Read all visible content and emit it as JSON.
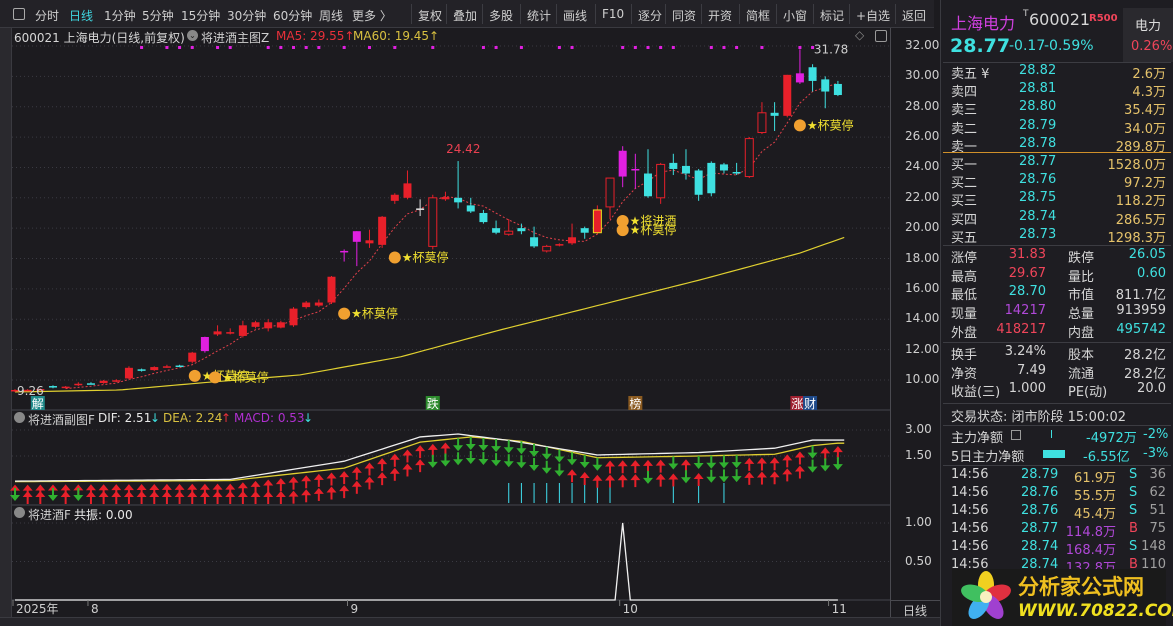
{
  "toolbar": {
    "periods": [
      "分时",
      "日线",
      "1分钟",
      "5分钟",
      "15分钟",
      "30分钟",
      "60分钟",
      "周线",
      "更多 〉"
    ],
    "active": "日线",
    "buttons": [
      "复权",
      "叠加",
      "多股",
      "统计",
      "画线",
      "F10",
      "逐分",
      "同资",
      "开资",
      "简框",
      "小窗",
      "标记",
      "+自选",
      "返回"
    ]
  },
  "header": {
    "title": "600021 上海电力(日线,前复权)",
    "indicator": "将进酒主图Z",
    "ma5": "MA5: 29.55↑",
    "ma60": "MA60: 19.45↑"
  },
  "macd_header": {
    "name": "将进酒副图F",
    "dif": "DIF: 2.51",
    "dif_arrow": "↓",
    "dea": "DEA: 2.24",
    "dea_arrow": "↑",
    "macd": "MACD: 0.53",
    "macd_arrow": "↓"
  },
  "res_header": {
    "name": "将进酒F",
    "value": "共振: 0.00"
  },
  "date_axis": {
    "labels": [
      {
        "text": "2025年",
        "i": 0
      },
      {
        "text": "8",
        "i": 6
      },
      {
        "text": "9",
        "i": 26.5
      },
      {
        "text": "10",
        "i": 48
      },
      {
        "text": "11",
        "i": 64.5
      }
    ],
    "period": "日线"
  },
  "event_tags": [
    {
      "text": "解",
      "i": 1.8,
      "color": "#1f8a8a"
    },
    {
      "text": "跌",
      "i": 33,
      "color": "#2c8a2c"
    },
    {
      "text": "榜",
      "i": 49,
      "color": "#8a5a20"
    },
    {
      "text": "涨",
      "i": 61.8,
      "color": "#a02030"
    },
    {
      "text": "财",
      "i": 62.8,
      "color": "#1f4a8a"
    }
  ],
  "chart_data": {
    "type": "candlestick",
    "price_axis": [
      "32.00",
      "30.00",
      "28.00",
      "26.00",
      "24.00",
      "22.00",
      "20.00",
      "18.00",
      "16.00",
      "14.00",
      "12.00",
      "10.00"
    ],
    "ylim": [
      10,
      32
    ],
    "candles": [
      [
        9.3,
        9.4,
        9.2,
        9.34
      ],
      [
        9.35,
        9.4,
        9.3,
        9.35
      ],
      [
        9.38,
        9.45,
        9.3,
        9.4
      ],
      [
        9.6,
        9.65,
        9.45,
        9.5
      ],
      [
        9.5,
        9.6,
        9.45,
        9.56
      ],
      [
        9.65,
        9.85,
        9.6,
        9.75
      ],
      [
        9.78,
        9.85,
        9.7,
        9.72
      ],
      [
        9.8,
        10.0,
        9.75,
        9.95
      ],
      [
        9.95,
        10.05,
        9.85,
        9.98
      ],
      [
        10.1,
        10.9,
        10.05,
        10.8
      ],
      [
        10.7,
        10.75,
        10.55,
        10.6
      ],
      [
        10.65,
        10.9,
        10.6,
        10.85
      ],
      [
        10.85,
        11.0,
        10.8,
        10.9
      ],
      [
        10.95,
        11.0,
        10.85,
        10.85
      ],
      [
        11.2,
        11.85,
        11.1,
        11.8
      ],
      [
        11.9,
        12.85,
        11.8,
        12.83
      ],
      [
        13.0,
        13.6,
        12.9,
        13.2
      ],
      [
        13.15,
        13.4,
        13.0,
        13.1
      ],
      [
        12.9,
        13.9,
        12.8,
        13.6
      ],
      [
        13.5,
        13.9,
        13.4,
        13.8
      ],
      [
        13.4,
        14.0,
        13.2,
        13.8
      ],
      [
        13.45,
        13.9,
        13.4,
        13.8
      ],
      [
        13.6,
        14.8,
        13.5,
        14.7
      ],
      [
        14.8,
        15.2,
        14.7,
        15.1
      ],
      [
        14.9,
        15.3,
        14.8,
        15.1
      ],
      [
        15.1,
        16.85,
        15.0,
        16.8
      ],
      [
        18.4,
        18.6,
        17.8,
        18.5
      ],
      [
        19.1,
        19.8,
        17.5,
        19.8
      ],
      [
        19.2,
        19.9,
        18.7,
        19.0
      ],
      [
        18.9,
        20.8,
        18.7,
        20.75
      ],
      [
        21.8,
        22.3,
        21.6,
        22.2
      ],
      [
        22.0,
        23.8,
        21.9,
        22.95
      ],
      [
        21.3,
        21.9,
        20.8,
        21.2
      ],
      [
        18.8,
        22.2,
        18.6,
        22.0
      ],
      [
        21.9,
        22.4,
        21.8,
        22.05
      ],
      [
        22.0,
        24.42,
        21.3,
        21.7
      ],
      [
        21.5,
        22.0,
        21.0,
        21.1
      ],
      [
        21.0,
        21.2,
        20.3,
        20.4
      ],
      [
        20.0,
        20.5,
        19.6,
        19.7
      ],
      [
        19.6,
        20.6,
        19.5,
        19.8
      ],
      [
        20.0,
        20.3,
        19.6,
        19.8
      ],
      [
        19.4,
        20.1,
        18.7,
        18.8
      ],
      [
        18.5,
        18.9,
        18.4,
        18.8
      ],
      [
        18.9,
        19.0,
        18.8,
        18.95
      ],
      [
        19.0,
        20.3,
        18.9,
        19.4
      ],
      [
        20.0,
        20.1,
        19.3,
        19.7
      ],
      [
        19.7,
        21.5,
        19.6,
        21.2
      ],
      [
        21.4,
        23.3,
        20.6,
        23.3
      ],
      [
        23.4,
        25.4,
        22.7,
        25.1
      ],
      [
        23.9,
        24.9,
        22.6,
        23.8
      ],
      [
        23.6,
        25.2,
        22.0,
        22.1
      ],
      [
        22.0,
        24.3,
        21.6,
        24.2
      ],
      [
        24.3,
        24.9,
        23.5,
        23.9
      ],
      [
        24.1,
        25.2,
        23.2,
        23.6
      ],
      [
        23.8,
        23.9,
        21.8,
        22.2
      ],
      [
        22.3,
        24.4,
        22.1,
        24.3
      ],
      [
        24.2,
        24.3,
        23.6,
        23.8
      ],
      [
        23.7,
        24.3,
        23.5,
        23.65
      ],
      [
        23.4,
        26.0,
        23.3,
        25.9
      ],
      [
        26.3,
        28.3,
        26.2,
        27.6
      ],
      [
        27.6,
        28.3,
        26.4,
        27.4
      ],
      [
        27.4,
        30.1,
        27.3,
        30.1
      ],
      [
        29.6,
        31.78,
        29.5,
        30.2
      ],
      [
        30.6,
        30.8,
        29.0,
        29.7
      ],
      [
        29.8,
        30.0,
        27.9,
        29.0
      ],
      [
        29.5,
        29.7,
        28.7,
        28.77
      ]
    ],
    "candle_styles": "rrrcrrcrrrcrrcrmrrrrrrrrrrmmrrrrwhrcccchcchrrcyhmmchcccccchhcrmccc",
    "ma60_points": [
      [
        0,
        9.21
      ],
      [
        8.3,
        9.34
      ],
      [
        14.6,
        9.8
      ],
      [
        22.5,
        10.33
      ],
      [
        30.4,
        11.51
      ],
      [
        38.3,
        13.29
      ],
      [
        46.2,
        14.94
      ],
      [
        54.1,
        16.59
      ],
      [
        62,
        18.36
      ],
      [
        65.6,
        19.42
      ]
    ],
    "signal_dots": [
      10,
      12,
      13,
      14,
      16,
      17,
      20,
      21,
      22,
      23,
      24,
      26,
      28,
      30,
      33,
      37,
      38,
      40,
      43,
      44,
      48,
      49,
      50,
      51,
      52,
      55,
      56,
      57,
      59,
      62,
      63
    ],
    "annotations": [
      {
        "text": "24.42",
        "i": 35,
        "price": 24.42
      },
      {
        "text": "31.78",
        "i": 62,
        "price": 31.78
      },
      {
        "text": "9.26",
        "i": 0,
        "price": 9.26
      }
    ],
    "signals": [
      {
        "i": 14.2,
        "price": 10.4,
        "label": "★杯莫停"
      },
      {
        "i": 15.8,
        "price": 10.3,
        "label": "★杯莫停"
      },
      {
        "i": 26,
        "price": 14.5,
        "label": "★杯莫停"
      },
      {
        "i": 30,
        "price": 18.2,
        "label": "★杯莫停"
      },
      {
        "i": 48,
        "price": 20.6,
        "label": "★将进酒"
      },
      {
        "i": 48,
        "price": 20.0,
        "label": "★杯莫停"
      },
      {
        "i": 62,
        "price": 26.9,
        "label": "★杯莫停"
      }
    ],
    "macd_axis": [
      "3.00",
      "1.50"
    ],
    "dif_points": [
      [
        0,
        0.05
      ],
      [
        17,
        0.15
      ],
      [
        26,
        1.2
      ],
      [
        32,
        2.6
      ],
      [
        35,
        2.77
      ],
      [
        39,
        2.4
      ],
      [
        46,
        1.56
      ],
      [
        54,
        1.7
      ],
      [
        60,
        1.95
      ],
      [
        63,
        2.42
      ],
      [
        65,
        2.42
      ]
    ],
    "dea_points": [
      [
        0,
        0.02
      ],
      [
        17,
        0.08
      ],
      [
        26,
        0.8
      ],
      [
        32,
        2.3
      ],
      [
        36,
        2.6
      ],
      [
        40,
        2.35
      ],
      [
        46,
        1.4
      ],
      [
        54,
        1.5
      ],
      [
        60,
        1.6
      ],
      [
        63,
        2.1
      ],
      [
        65,
        2.24
      ]
    ],
    "macd_upper": "UUUUUUUUUUUUUUUUUUUUUUUUUUUUUUUUUUUDDDDDDDDDDDDUUUUUDUDDDDUUUUUDUU",
    "macd_lower": "DUUDUDUUUUUUUUUUUUUUUUUUUUUUUUUUUDDDDDDDDDDDUUUUUUDUUDUDDDUUUUUDDD",
    "macd_cyan": [
      39,
      40,
      41,
      42,
      43,
      44,
      45,
      46,
      47,
      52,
      54,
      56
    ],
    "res_axis": [
      "1.00",
      "0.50"
    ],
    "resonance": {
      "ylim": [
        0,
        1
      ],
      "spike_index": 48,
      "spike_value": 1
    }
  },
  "quote": {
    "name": "上海电力",
    "code_prefix": "T",
    "code": "600021",
    "tag": "R500",
    "sector": "电力",
    "sector_pct": "0.26%",
    "price": "28.77",
    "change": "-0.17",
    "pct": "-0.59%"
  },
  "orderbook": {
    "sell": [
      [
        "卖五 ¥",
        "28.82",
        "2.6万"
      ],
      [
        "卖四",
        "28.81",
        "4.3万"
      ],
      [
        "卖三",
        "28.80",
        "35.4万"
      ],
      [
        "卖二",
        "28.79",
        "34.0万"
      ],
      [
        "卖一",
        "28.78",
        "289.8万"
      ]
    ],
    "buy": [
      [
        "买一",
        "28.77",
        "1528.0万"
      ],
      [
        "买二",
        "28.76",
        "97.2万"
      ],
      [
        "买三",
        "28.75",
        "118.2万"
      ],
      [
        "买四",
        "28.74",
        "286.5万"
      ],
      [
        "买五",
        "28.73",
        "1298.3万"
      ]
    ]
  },
  "stats": [
    [
      "涨停",
      "31.83",
      "跌停",
      "26.05"
    ],
    [
      "最高",
      "29.67",
      "量比",
      "0.60"
    ],
    [
      "最低",
      "28.70",
      "市值",
      "811.7亿"
    ],
    [
      "现量",
      "14217",
      "总量",
      "913959"
    ],
    [
      "外盘",
      "418217",
      "内盘",
      "495742"
    ]
  ],
  "stats2": [
    [
      "换手",
      "3.24%",
      "股本",
      "28.2亿"
    ],
    [
      "净资",
      "7.49",
      "流通",
      "28.2亿"
    ],
    [
      "收益(三)",
      "1.000",
      "PE(动)",
      "20.0"
    ]
  ],
  "trade_status": "交易状态: 闭市阶段 15:00:02",
  "main_flow": {
    "label": "主力净额",
    "value": "-4972万",
    "pct": "-2%"
  },
  "flow5": {
    "label": "5日主力净额",
    "value": "-6.55亿",
    "pct": "-3%"
  },
  "trades": [
    [
      "14:56",
      "28.79",
      "61.9万",
      "S",
      "36"
    ],
    [
      "14:56",
      "28.76",
      "55.5万",
      "S",
      "62"
    ],
    [
      "14:56",
      "28.76",
      "45.4万",
      "S",
      "51"
    ],
    [
      "14:56",
      "28.77",
      "114.8万",
      "B",
      "75"
    ],
    [
      "14:56",
      "28.74",
      "168.4万",
      "S",
      "148"
    ],
    [
      "14:56",
      "28.74",
      "132.8万",
      "B",
      "110"
    ]
  ],
  "logo": {
    "title": "分析家公式网",
    "url": "WWW.70822.COM"
  },
  "colors": {
    "up": "#e8202a",
    "down": "#3fe0e0",
    "magenta": "#e020e0",
    "ma60": "#e0d030",
    "ma5": "#e0404a"
  }
}
